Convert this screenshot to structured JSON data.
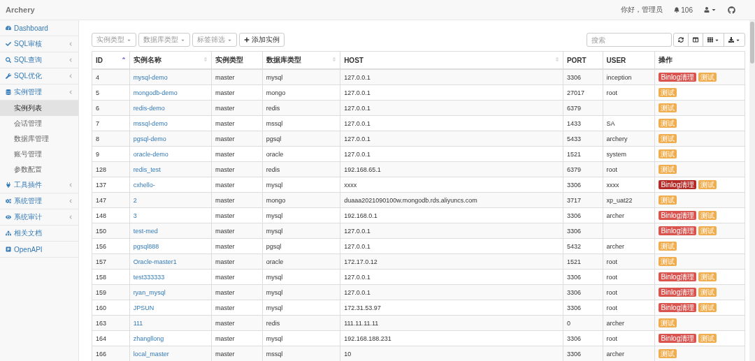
{
  "header": {
    "brand": "Archery",
    "greeting": "你好，管理员",
    "notifications": "106"
  },
  "sidebar": {
    "items": [
      {
        "label": "Dashboard",
        "kind": "link"
      },
      {
        "label": "SQL审核",
        "kind": "group"
      },
      {
        "label": "SQL查询",
        "kind": "group"
      },
      {
        "label": "SQL优化",
        "kind": "group"
      },
      {
        "label": "实例管理",
        "kind": "group",
        "children": [
          {
            "label": "实例列表",
            "selected": true
          },
          {
            "label": "会话管理",
            "selected": false
          },
          {
            "label": "数据库管理",
            "selected": false
          },
          {
            "label": "账号管理",
            "selected": false
          },
          {
            "label": "参数配置",
            "selected": false
          }
        ]
      },
      {
        "label": "工具插件",
        "kind": "group"
      },
      {
        "label": "系统管理",
        "kind": "group"
      },
      {
        "label": "系统审计",
        "kind": "group"
      },
      {
        "label": "相关文档",
        "kind": "link"
      },
      {
        "label": "OpenAPI",
        "kind": "link"
      }
    ]
  },
  "toolbar": {
    "filters": [
      "实例类型",
      "数据库类型",
      "标签筛选"
    ],
    "add_button": "添加实例",
    "search": {
      "placeholder": "搜索"
    }
  },
  "table": {
    "columns": [
      {
        "label": "ID",
        "sortable": true,
        "sorted": true
      },
      {
        "label": "实例名称",
        "sortable": true,
        "sorted": false
      },
      {
        "label": "实例类型",
        "sortable": false
      },
      {
        "label": "数据库类型",
        "sortable": true,
        "sorted": false
      },
      {
        "label": "HOST",
        "sortable": true,
        "sorted": false
      },
      {
        "label": "PORT",
        "sortable": false
      },
      {
        "label": "USER",
        "sortable": false
      },
      {
        "label": "操作",
        "sortable": false
      }
    ],
    "rows": [
      {
        "id": "4",
        "name": "mysql-demo",
        "type": "master",
        "db_type": "mysql",
        "host": "127.0.0.1",
        "port": "3306",
        "user": "inception",
        "actions": [
          {
            "kind": "binlog",
            "label": "Binlog清理",
            "active": false
          },
          {
            "kind": "test",
            "label": "测试",
            "active": false
          }
        ]
      },
      {
        "id": "5",
        "name": "mongodb-demo",
        "type": "master",
        "db_type": "mongo",
        "host": "127.0.0.1",
        "port": "27017",
        "user": "root",
        "actions": [
          {
            "kind": "test",
            "label": "测试",
            "active": false
          }
        ]
      },
      {
        "id": "6",
        "name": "redis-demo",
        "type": "master",
        "db_type": "redis",
        "host": "127.0.0.1",
        "port": "6379",
        "user": "",
        "actions": [
          {
            "kind": "test",
            "label": "测试",
            "active": false
          }
        ]
      },
      {
        "id": "7",
        "name": "mssql-demo",
        "type": "master",
        "db_type": "mssql",
        "host": "127.0.0.1",
        "port": "1433",
        "user": "SA",
        "actions": [
          {
            "kind": "test",
            "label": "测试",
            "active": false
          }
        ]
      },
      {
        "id": "8",
        "name": "pgsql-demo",
        "type": "master",
        "db_type": "pgsql",
        "host": "127.0.0.1",
        "port": "5433",
        "user": "archery",
        "actions": [
          {
            "kind": "test",
            "label": "测试",
            "active": false
          }
        ]
      },
      {
        "id": "9",
        "name": "oracle-demo",
        "type": "master",
        "db_type": "oracle",
        "host": "127.0.0.1",
        "port": "1521",
        "user": "system",
        "actions": [
          {
            "kind": "test",
            "label": "测试",
            "active": false
          }
        ]
      },
      {
        "id": "128",
        "name": "redis_test",
        "type": "master",
        "db_type": "redis",
        "host": "192.168.65.1",
        "port": "6379",
        "user": "root",
        "actions": [
          {
            "kind": "test",
            "label": "测试",
            "active": false
          }
        ]
      },
      {
        "id": "137",
        "name": "cxhello-",
        "type": "master",
        "db_type": "mysql",
        "host": "xxxx",
        "port": "3306",
        "user": "xxxx",
        "actions": [
          {
            "kind": "binlog",
            "label": "Binlog清理",
            "active": true
          },
          {
            "kind": "test",
            "label": "测试",
            "active": false
          }
        ]
      },
      {
        "id": "147",
        "name": "2",
        "type": "master",
        "db_type": "mongo",
        "host": "duaaa2021090100w.mongodb.rds.aliyuncs.com",
        "port": "3717",
        "user": "xp_uat22",
        "actions": [
          {
            "kind": "test",
            "label": "测试",
            "active": false
          }
        ]
      },
      {
        "id": "148",
        "name": "3",
        "type": "master",
        "db_type": "mysql",
        "host": "192.168.0.1",
        "port": "3306",
        "user": "archer",
        "actions": [
          {
            "kind": "binlog",
            "label": "Binlog清理",
            "active": false
          },
          {
            "kind": "test",
            "label": "测试",
            "active": false
          }
        ]
      },
      {
        "id": "150",
        "name": "test-med",
        "type": "master",
        "db_type": "mysql",
        "host": "127.0.0.1",
        "port": "3306",
        "user": "",
        "actions": [
          {
            "kind": "binlog",
            "label": "Binlog清理",
            "active": false
          },
          {
            "kind": "test",
            "label": "测试",
            "active": false
          }
        ]
      },
      {
        "id": "156",
        "name": "pgsql888",
        "type": "master",
        "db_type": "pgsql",
        "host": "127.0.0.1",
        "port": "5432",
        "user": "archer",
        "actions": [
          {
            "kind": "test",
            "label": "测试",
            "active": false
          }
        ]
      },
      {
        "id": "157",
        "name": "Oracle-master1",
        "type": "master",
        "db_type": "oracle",
        "host": "172.17.0.12",
        "port": "1521",
        "user": "root",
        "actions": [
          {
            "kind": "test",
            "label": "测试",
            "active": false
          }
        ]
      },
      {
        "id": "158",
        "name": "test333333",
        "type": "master",
        "db_type": "mysql",
        "host": "127.0.0.1",
        "port": "3306",
        "user": "root",
        "actions": [
          {
            "kind": "binlog",
            "label": "Binlog清理",
            "active": false
          },
          {
            "kind": "test",
            "label": "测试",
            "active": false
          }
        ]
      },
      {
        "id": "159",
        "name": "ryan_mysql",
        "type": "master",
        "db_type": "mysql",
        "host": "127.0.0.1",
        "port": "3306",
        "user": "root",
        "actions": [
          {
            "kind": "binlog",
            "label": "Binlog清理",
            "active": false
          },
          {
            "kind": "test",
            "label": "测试",
            "active": false
          }
        ]
      },
      {
        "id": "160",
        "name": "JPSUN",
        "type": "master",
        "db_type": "mysql",
        "host": "172.31.53.97",
        "port": "3306",
        "user": "root",
        "actions": [
          {
            "kind": "binlog",
            "label": "Binlog清理",
            "active": false
          },
          {
            "kind": "test",
            "label": "测试",
            "active": false
          }
        ]
      },
      {
        "id": "163",
        "name": "111",
        "type": "master",
        "db_type": "redis",
        "host": "111.11.11.11",
        "port": "0",
        "user": "archer",
        "actions": [
          {
            "kind": "test",
            "label": "测试",
            "active": false
          }
        ]
      },
      {
        "id": "164",
        "name": "zhangllong",
        "type": "master",
        "db_type": "mysql",
        "host": "192.168.188.231",
        "port": "3306",
        "user": "root",
        "actions": [
          {
            "kind": "binlog",
            "label": "Binlog清理",
            "active": false
          },
          {
            "kind": "test",
            "label": "测试",
            "active": false
          }
        ]
      },
      {
        "id": "166",
        "name": "local_master",
        "type": "master",
        "db_type": "mssql",
        "host": "10",
        "port": "3306",
        "user": "archer",
        "actions": [
          {
            "kind": "test",
            "label": "测试",
            "active": false
          }
        ]
      }
    ]
  }
}
